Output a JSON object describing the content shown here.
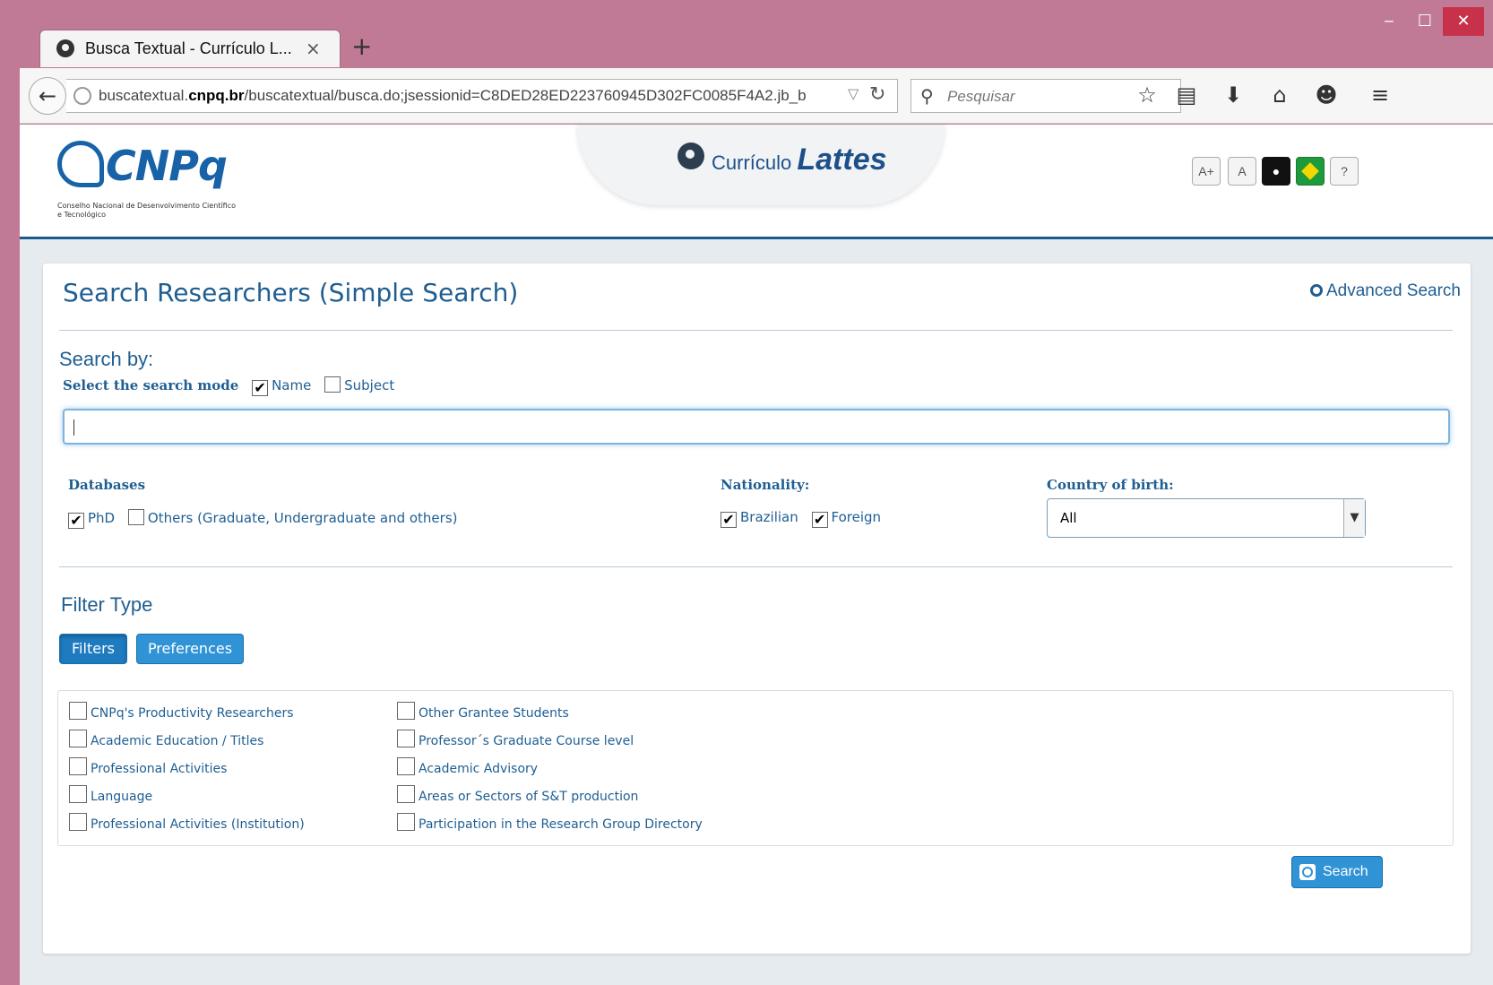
{
  "browser": {
    "tab_title": "Busca Textual - Currículo L...",
    "tab_close": "×",
    "new_tab": "+",
    "url_prefix": "buscatextual.",
    "url_domain": "cnpq.br",
    "url_path": "/buscatextual/busca.do;jsessionid=C8DED28ED223760945D302FC0085F4A2.jb_b",
    "search_placeholder": "Pesquisar",
    "window_controls": {
      "minimize": "‒",
      "maximize": "☐",
      "close": "✕"
    },
    "toolbar_icons": [
      "star-icon",
      "reading-list-icon",
      "download-icon",
      "home-icon",
      "chat-icon",
      "menu-icon"
    ]
  },
  "header": {
    "logo_text": "CNPq",
    "logo_sub": "Conselho Nacional de Desenvolvimento Científico e Tecnológico",
    "lattes_small": "Currículo",
    "lattes_big": "Lattes",
    "accessibility": {
      "increase": "A+",
      "normal": "A",
      "help": "?"
    }
  },
  "form": {
    "title": "Search Researchers (Simple Search)",
    "advanced_link": "Advanced Search",
    "search_by": "Search by:",
    "mode_label": "Select the search mode",
    "mode_options": [
      {
        "label": "Name",
        "checked": true
      },
      {
        "label": "Subject",
        "checked": false
      }
    ],
    "query_value": "",
    "databases": {
      "label": "Databases",
      "options": [
        {
          "label": "PhD",
          "checked": true
        },
        {
          "label": "Others (Graduate, Undergraduate and others)",
          "checked": false
        }
      ]
    },
    "nationality": {
      "label": "Nationality:",
      "options": [
        {
          "label": "Brazilian",
          "checked": true
        },
        {
          "label": "Foreign",
          "checked": true
        }
      ]
    },
    "country": {
      "label": "Country of birth:",
      "selected": "All"
    },
    "filter_type": {
      "title": "Filter Type",
      "buttons": [
        "Filters",
        "Preferences"
      ],
      "left_column": [
        "CNPq's Productivity Researchers",
        "Academic Education / Titles",
        "Professional Activities",
        "Language",
        "Professional Activities (Institution)"
      ],
      "right_column": [
        "Other Grantee Students",
        "Professor´s Graduate Course level",
        "Academic Advisory",
        "Areas or Sectors of S&T production",
        "Participation in the Research Group Directory"
      ]
    },
    "search_button": "Search"
  },
  "colors": {
    "accent": "#1f5e92",
    "button": "#2f93d6",
    "frame": "#c07a96"
  }
}
